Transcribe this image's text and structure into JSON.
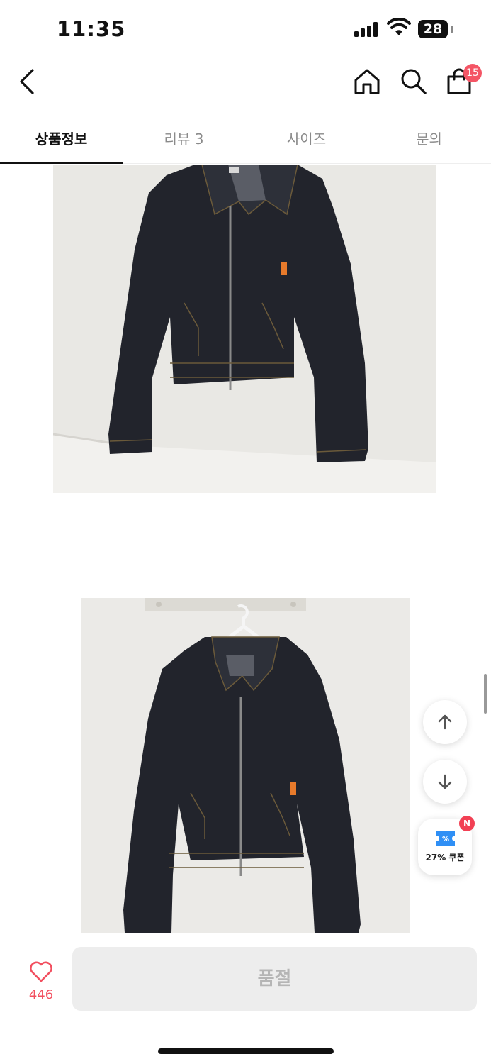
{
  "status_bar": {
    "time": "11:35",
    "battery": "28",
    "signal_icon": "cellular-signal-icon",
    "wifi_icon": "wifi-icon",
    "battery_icon": "battery-icon"
  },
  "nav": {
    "back_icon": "chevron-left-icon",
    "home_icon": "home-icon",
    "search_icon": "search-icon",
    "cart_icon": "shopping-bag-icon",
    "cart_badge": "15"
  },
  "tabs": [
    {
      "label": "상품정보",
      "active": true
    },
    {
      "label": "리뷰 3",
      "active": false
    },
    {
      "label": "사이즈",
      "active": false
    },
    {
      "label": "문의",
      "active": false
    }
  ],
  "floating": {
    "scroll_up_icon": "arrow-up-icon",
    "scroll_down_icon": "arrow-down-icon",
    "coupon_icon": "coupon-ticket-icon",
    "coupon_label": "27% 쿠폰",
    "coupon_badge": "N"
  },
  "bottom_bar": {
    "like_icon": "heart-icon",
    "like_count": "446",
    "buy_label": "품절"
  },
  "colors": {
    "accent": "#f24f5f",
    "disabled_button": "#ededed",
    "coupon_blue": "#2f8ff5"
  }
}
